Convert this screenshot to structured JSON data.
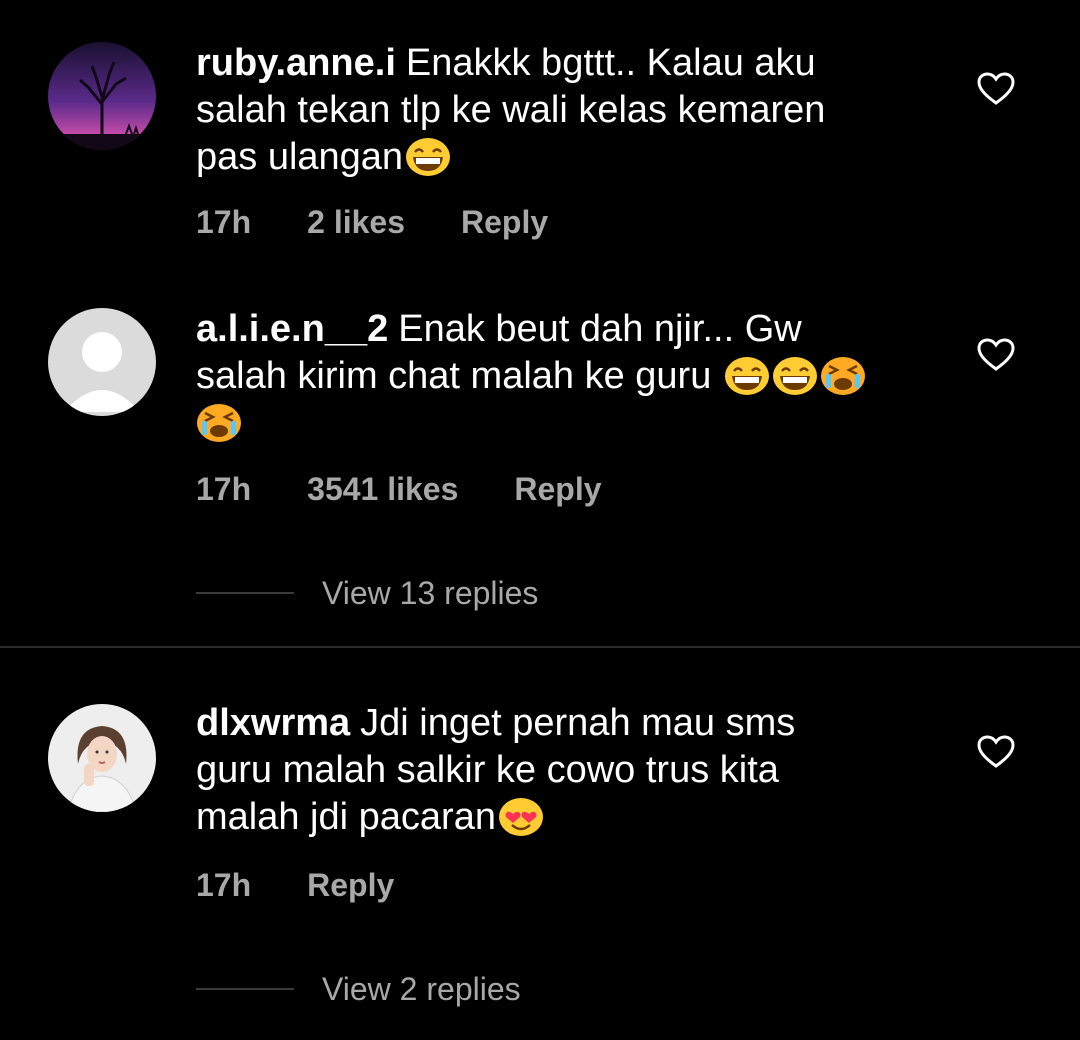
{
  "colors": {
    "background": "#000000",
    "text_primary": "#ffffff",
    "text_secondary": "#a8a8a8",
    "emoji_yellow": "#ffcc33"
  },
  "comments": [
    {
      "username": "ruby.anne.i",
      "text_lines": [
        "Enakkk bgttt.. Kalau aku",
        "salah tekan tlp ke wali kelas kemaren",
        "pas ulangan"
      ],
      "emojis": [
        "laughing-emoji"
      ],
      "time": "17h",
      "likes": "2 likes",
      "reply_label": "Reply",
      "avatar_icon": "tree-silhouette-avatar"
    },
    {
      "username": "a.l.i.e.n__2",
      "text_lines": [
        "Enak beut dah njir... Gw",
        "salah kirim chat malah ke guru"
      ],
      "emojis": [
        "laughing-emoji",
        "laughing-emoji",
        "crying-emoji",
        "crying-emoji"
      ],
      "time": "17h",
      "likes": "3541 likes",
      "reply_label": "Reply",
      "view_replies": "View 13 replies",
      "avatar_icon": "default-user-avatar"
    },
    {
      "username": "dlxwrma",
      "text_lines": [
        "Jdi inget pernah mau sms",
        "guru malah salkir ke cowo trus kita",
        "malah jdi pacaran"
      ],
      "emojis": [
        "heart-eyes-emoji"
      ],
      "time": "17h",
      "reply_label": "Reply",
      "view_replies": "View 2 replies",
      "avatar_icon": "person-photo-avatar"
    }
  ]
}
